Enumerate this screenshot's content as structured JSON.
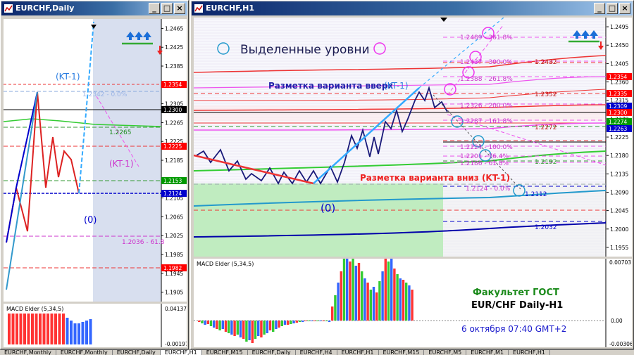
{
  "windows": {
    "daily": {
      "title": "EURCHF,Daily",
      "price_scale": [
        "1.2465",
        "1.2425",
        "1.2385",
        "1.2345",
        "1.2305",
        "1.2265",
        "1.2225",
        "1.2185",
        "1.2145",
        "1.2105",
        "1.2065",
        "1.2025",
        "1.1985",
        "1.1945",
        "1.1905"
      ],
      "price_tags": [
        "1.2354",
        "1.2300",
        "1.2225",
        "1.2153",
        "1.2124",
        "1.1982"
      ],
      "labels": {
        "kt1_top": "(KT-1)",
        "lvl_0": "1.2342 - 0.0%",
        "lvl_1": "1.2265",
        "kt1_mid": "(KT-1)",
        "zero": "(0)",
        "lvl_618": "1.2036 - 61.8"
      },
      "macd": {
        "title": "MACD Elder (5,34,5)",
        "scale_top": "0.04137",
        "scale_bot": "-0.00197"
      }
    },
    "h1": {
      "title": "EURCHF,H1",
      "price_scale": [
        "1.2495",
        "1.2450",
        "1.2405",
        "1.2360",
        "1.2315",
        "1.2270",
        "1.2225",
        "1.2180",
        "1.2135",
        "1.2090",
        "1.2045",
        "1.2000",
        "1.1955"
      ],
      "price_tags": [
        "1.2354",
        "1.2335",
        "1.2309",
        "1.2300",
        "1.2274",
        "1.2263"
      ],
      "legend_text": "Выделенные уровни",
      "labels": {
        "fib_3618": "1.2489 - 361.8%",
        "fib_300": "1.2437 - 300.0%",
        "fib_2618": "1.2388 - 261.8%",
        "fib_200": "1.2326 - 200.0%",
        "fib_1618": "1.2287 - 161.8%",
        "fib_100": "1.2224 - 100.0%",
        "fib_764": "1.2201 - 76.4%",
        "fib_618": "1.2186 - 61.8%",
        "fib_0": "1.2124 - 0.0%",
        "r_2432": "1.2432",
        "r_2352": "1.2352",
        "r_2272": "1.2272",
        "r_2192": "1.2192",
        "r_2112": "1.2112",
        "r_2032": "1.2032",
        "markup_up": "Разметка варианта вверх",
        "markup_up_kt": "(KT-1)",
        "markup_down": "Разметка варианта вниз (KT-1)",
        "zero": "(0)"
      },
      "macd": {
        "title": "MACD Elder (5,34,5)",
        "scale_top": "0.00703",
        "scale_zero": "0.00",
        "scale_bot": "-0.00306"
      },
      "caption": {
        "line1": "Факультет ГОСТ",
        "line2": "EUR/CHF Daily-H1",
        "line3": "6 октября 07:40 GMT+2"
      }
    }
  },
  "tabs": [
    "EURCHF,Monthly",
    "EURCHF,Monthly",
    "EURCHF,Daily",
    "EURCHF,H1",
    "EURCHF,M15",
    "EURCHF,Daily",
    "EURCHF,H4",
    "EURCHF,H1",
    "EURCHF,M15",
    "EURCHF,M5",
    "EURCHF,M1",
    "EURCHF,H1"
  ],
  "colors": {
    "title_bar": "#0a246a",
    "tag_red": "#ff0000",
    "tag_black": "#000000",
    "tag_green": "#009900",
    "tag_blue": "#0000cc",
    "macd_red": "#ff3333",
    "macd_green": "#33cc33",
    "macd_blue": "#3366ff"
  }
}
